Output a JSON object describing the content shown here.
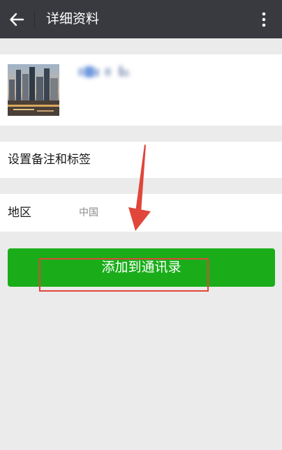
{
  "header": {
    "title": "详细资料",
    "back_icon": "arrow-left-icon",
    "more_icon": "more-vertical-icon"
  },
  "profile": {
    "avatar": "city-skyline-photo"
  },
  "remark": {
    "label": "设置备注和标签"
  },
  "region": {
    "label": "地区",
    "value": "中国"
  },
  "actions": {
    "add_contact_label": "添加到通讯录"
  },
  "colors": {
    "topbar": "#393a3f",
    "background": "#ebebeb",
    "primary_button": "#1aad19",
    "annotation": "#e0463a"
  }
}
